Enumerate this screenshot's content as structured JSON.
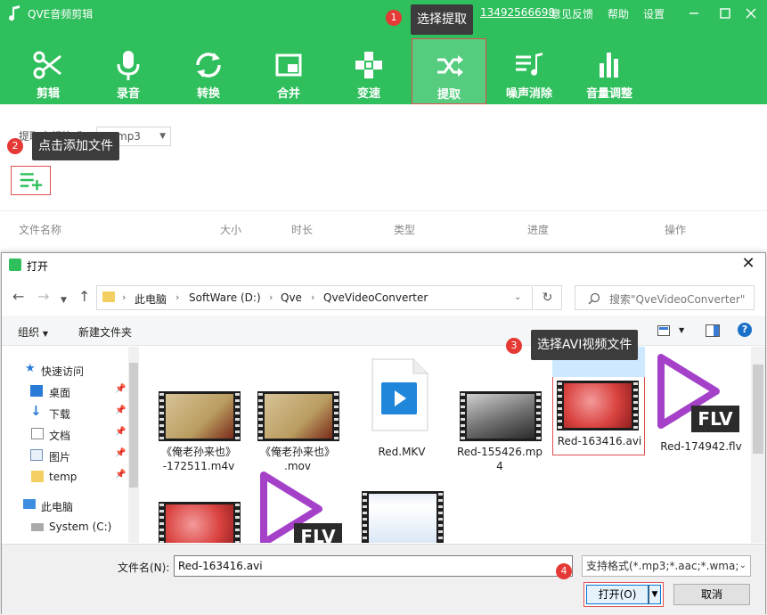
{
  "app": {
    "title": "QVE音频剪辑",
    "phone": "13492566698",
    "links": [
      "意见反馈",
      "帮助",
      "设置"
    ]
  },
  "toolbar": {
    "tools": [
      {
        "label": "剪辑",
        "icon": "scissors-icon"
      },
      {
        "label": "录音",
        "icon": "microphone-icon"
      },
      {
        "label": "转换",
        "icon": "convert-icon"
      },
      {
        "label": "合并",
        "icon": "merge-icon"
      },
      {
        "label": "变速",
        "icon": "speed-icon"
      },
      {
        "label": "提取",
        "icon": "extract-shuffle-icon",
        "active": true
      },
      {
        "label": "噪声消除",
        "icon": "noise-reduction-icon"
      },
      {
        "label": "音量调整",
        "icon": "volume-bars-icon"
      }
    ]
  },
  "callouts": [
    {
      "num": "1",
      "text": "选择提取"
    },
    {
      "num": "2",
      "text": "点击添加文件"
    },
    {
      "num": "3",
      "text": "选择AVI视频文件"
    },
    {
      "num": "4",
      "text": ""
    }
  ],
  "extract": {
    "format_label": "提取音频格式",
    "format_value": "mp3"
  },
  "file_list": {
    "columns": [
      "文件名称",
      "大小",
      "时长",
      "类型",
      "进度",
      "操作"
    ]
  },
  "dialog": {
    "title": "打开",
    "breadcrumb": [
      "此电脑",
      "SoftWare (D:)",
      "Qve",
      "QveVideoConverter"
    ],
    "search_placeholder": "搜索\"QveVideoConverter\"",
    "commands": {
      "organize": "组织",
      "new_folder": "新建文件夹"
    },
    "sidebar": [
      {
        "label": "快速访问",
        "icon": "star-icon"
      },
      {
        "label": "桌面",
        "icon": "desktop-icon",
        "pinned": true
      },
      {
        "label": "下载",
        "icon": "download-icon",
        "pinned": true
      },
      {
        "label": "文档",
        "icon": "document-icon",
        "pinned": true
      },
      {
        "label": "图片",
        "icon": "pictures-icon",
        "pinned": true
      },
      {
        "label": "temp",
        "icon": "folder-icon",
        "pinned": true
      },
      {
        "label": "此电脑",
        "icon": "computer-icon"
      },
      {
        "label": "System (C:)",
        "icon": "drive-icon"
      }
    ],
    "files": [
      {
        "line1": "《俺老孙来也》",
        "line2": "-172511.m4v"
      },
      {
        "line1": "《俺老孙来也》",
        "line2": ".mov"
      },
      {
        "line1": "Red.MKV",
        "line2": ""
      },
      {
        "line1": "Red-155426.mp",
        "line2": "4"
      },
      {
        "line1": "Red-163416.avi",
        "line2": "",
        "selected": true
      },
      {
        "line1": "Red-174942.flv",
        "line2": ""
      }
    ],
    "flv_badge": "FLV",
    "filename_label": "文件名(N):",
    "filename_value": "Red-163416.avi",
    "filter_value": "支持格式(*.mp3;*.aac;*.wma;*",
    "open_label": "打开(O)",
    "cancel_label": "取消"
  },
  "colors": {
    "brand_green": "#2fbf5c",
    "highlight_red": "#e05050",
    "badge_red": "#e53935"
  }
}
